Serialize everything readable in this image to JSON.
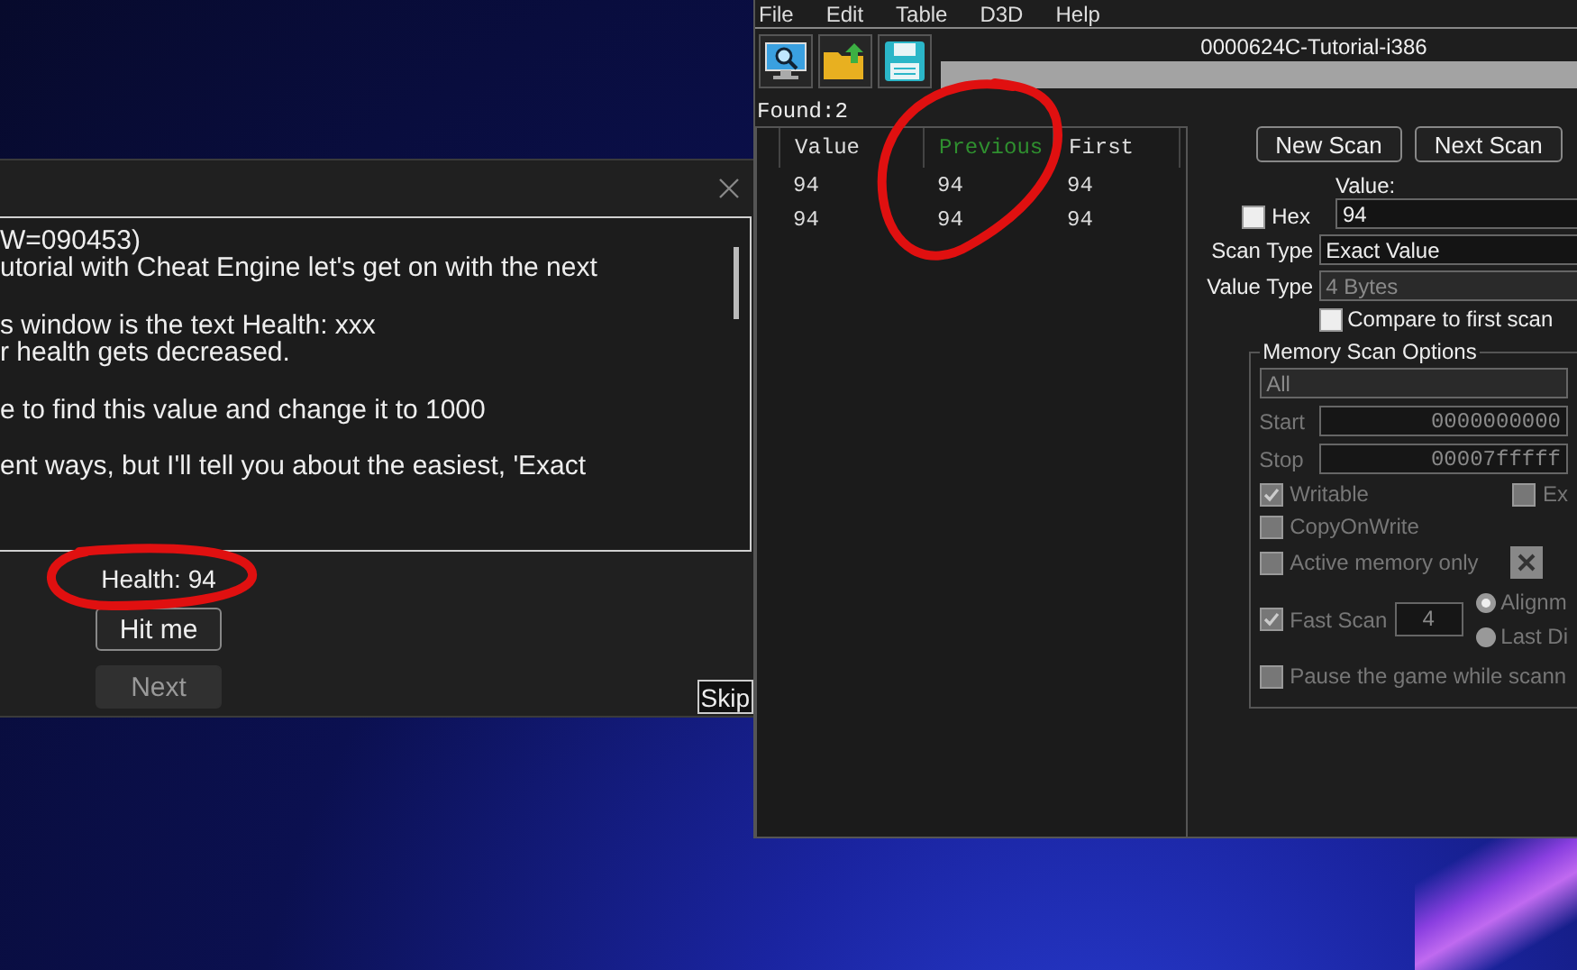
{
  "tutorial_window": {
    "text_paragraphs": [
      [
        "W=090453)",
        "utorial with Cheat Engine let's get on with the next"
      ],
      [
        "s window is the text Health: xxx",
        "r health gets decreased."
      ],
      [
        "e to find this value and change it to 1000"
      ],
      [
        "ent ways, but I'll tell you about the easiest, 'Exact"
      ]
    ],
    "health": "Health: 94",
    "buttons": [
      {
        "label": "Hit me",
        "disabled": false
      },
      {
        "label": "Next",
        "disabled": true
      }
    ],
    "skip": "Skip"
  },
  "cheat_engine": {
    "menu": [
      "File",
      "Edit",
      "Table",
      "D3D",
      "Help"
    ],
    "process_title": "0000624C-Tutorial-i386",
    "scan_progress": {
      "level": 0
    },
    "found": "Found:2",
    "results": {
      "columns": [
        {
          "label": "Value",
          "highlighted": false
        },
        {
          "label": "Previous",
          "highlighted": true
        },
        {
          "label": "First",
          "highlighted": false
        }
      ],
      "rows": [
        [
          "94",
          "94",
          "94"
        ],
        [
          "94",
          "94",
          "94"
        ]
      ]
    },
    "scan_buttons": [
      "New Scan",
      "Next Scan"
    ],
    "hex": {
      "label": "Hex",
      "checked": false
    },
    "value_label": "Value:",
    "value": "94",
    "scan_type": {
      "label": "Scan Type",
      "value": "Exact Value",
      "disabled": false
    },
    "value_type": {
      "label": "Value Type",
      "value": "4 Bytes",
      "disabled": true
    },
    "compare_first": {
      "label": "Compare to first scan",
      "checked": false
    },
    "memory_options": {
      "title": "Memory Scan Options",
      "region": "All",
      "start": {
        "label": "Start",
        "value": "0000000000"
      },
      "stop": {
        "label": "Stop",
        "value": "00007fffff"
      },
      "writable": {
        "label": "Writable",
        "checked": true
      },
      "executable": {
        "label": "Ex",
        "checked": false
      },
      "copy_on_write": {
        "label": "CopyOnWrite",
        "checked": false
      },
      "active_memory_only": {
        "label": "Active memory only",
        "checked": false
      },
      "fast_scan": {
        "label": "Fast Scan",
        "checked": true,
        "value": "4"
      },
      "alignment": [
        {
          "label": "Alignm",
          "selected": true
        },
        {
          "label": "Last Di",
          "selected": false
        }
      ],
      "pause": {
        "label": "Pause the game while scann",
        "checked": false
      }
    }
  }
}
